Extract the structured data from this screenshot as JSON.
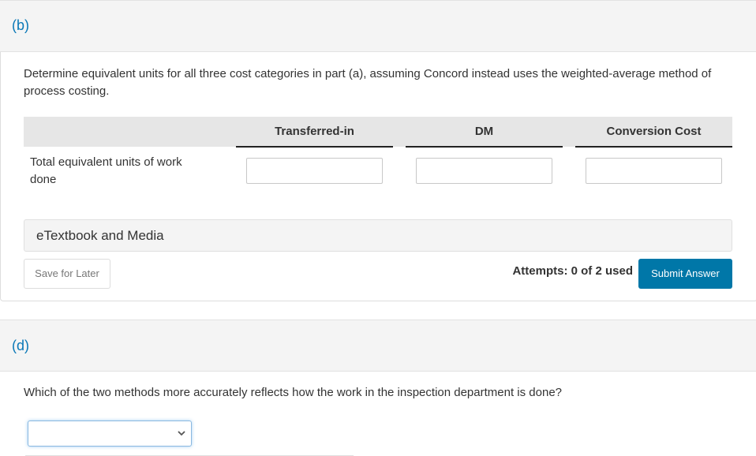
{
  "part_b": {
    "label": "(b)",
    "question": "Determine equivalent units for all three cost categories in part (a), assuming Concord instead uses the weighted-average method of process costing.",
    "table": {
      "columns": [
        "Transferred-in",
        "DM",
        "Conversion Cost"
      ],
      "rows": [
        {
          "label": "Total equivalent units of work done",
          "values": [
            "",
            "",
            ""
          ]
        }
      ]
    },
    "etextbook_label": "eTextbook and Media",
    "save_label": "Save for Later",
    "attempts_text": "Attempts: 0 of 2 used",
    "submit_label": "Submit Answer"
  },
  "part_d": {
    "label": "(d)",
    "question": "Which of the two methods more accurately reflects how the work in the inspection department is done?",
    "select_value": ""
  },
  "colors": {
    "accent": "#0a78b7",
    "submit_bg": "#0077a8",
    "header_bg": "#f4f4f4",
    "table_head_bg": "#e6e6e6"
  }
}
